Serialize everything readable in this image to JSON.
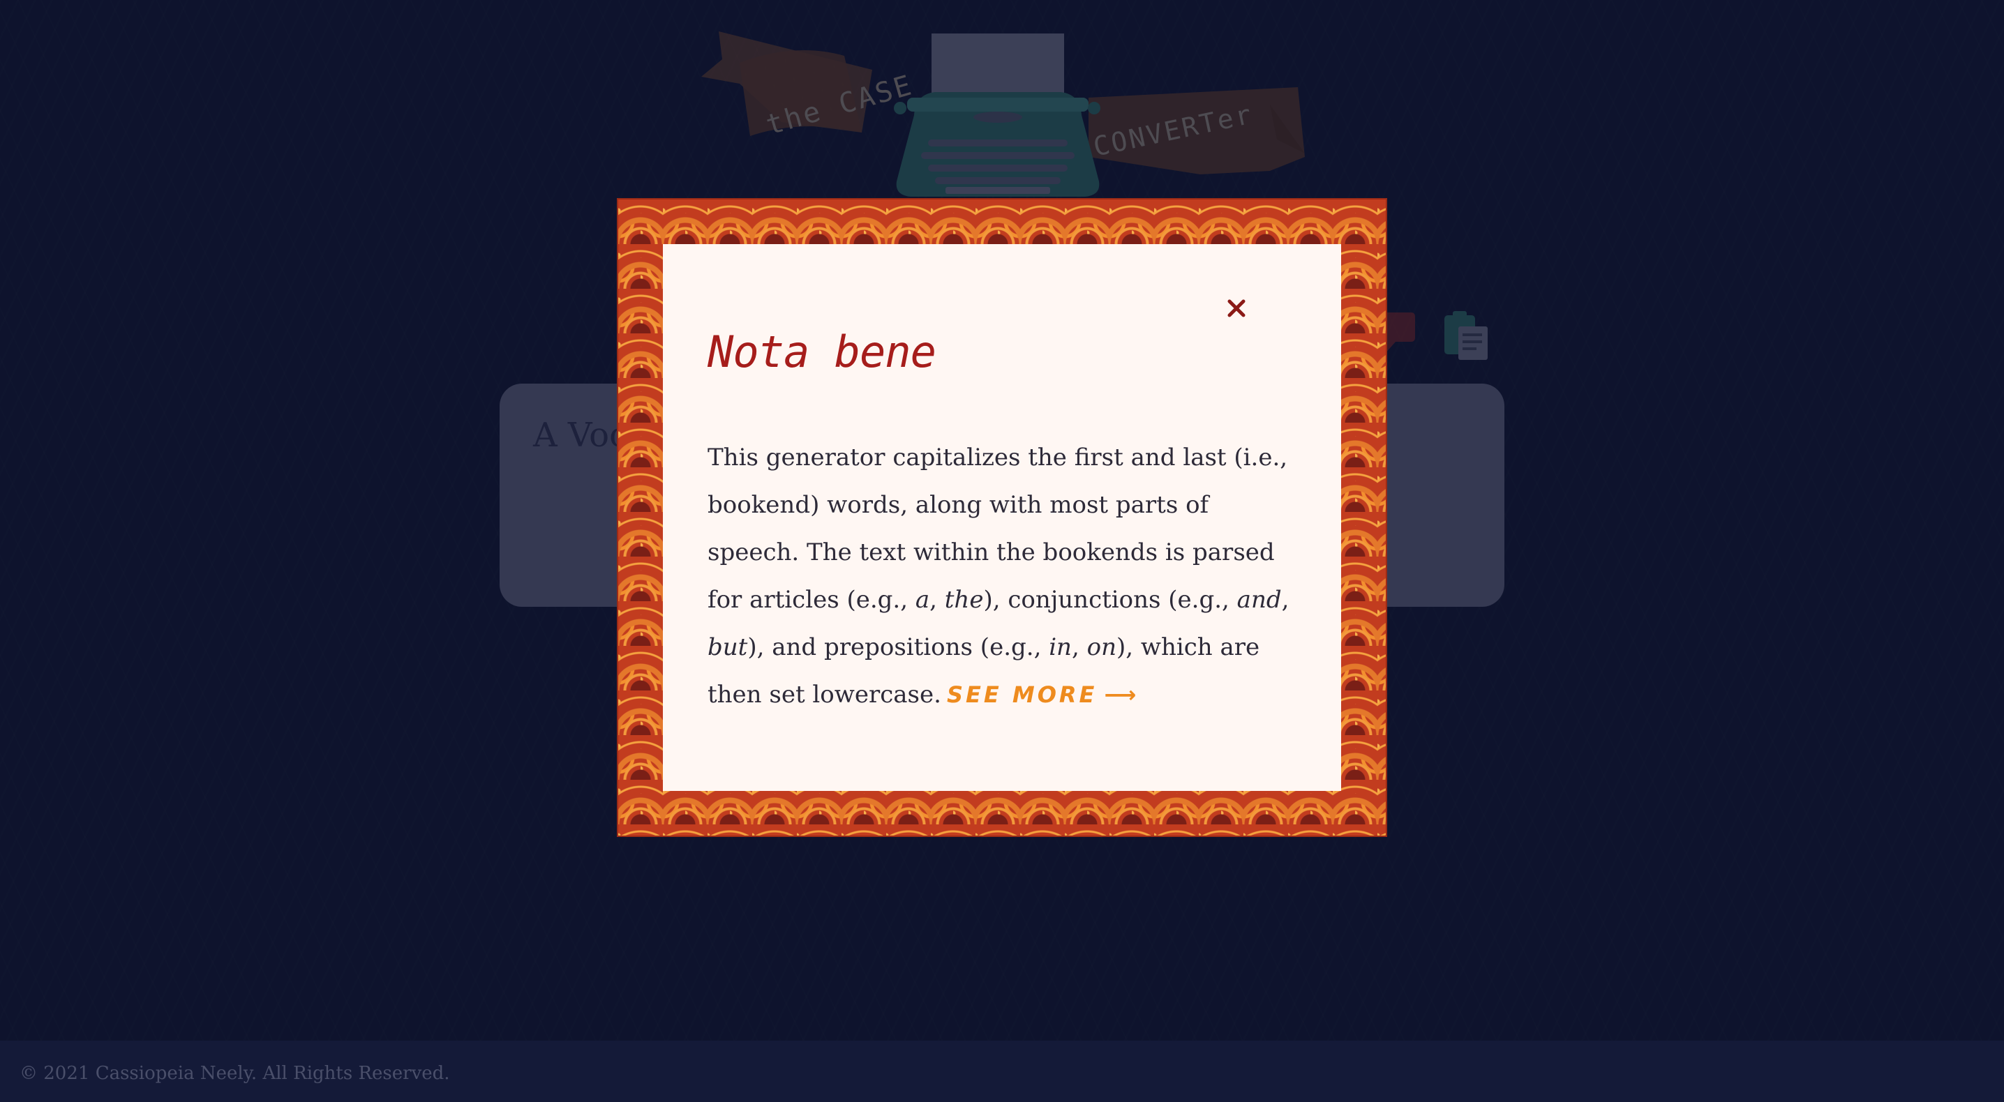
{
  "logo": {
    "left_ribbon": "the CASE",
    "right_ribbon": "CONVERTer"
  },
  "textbox": {
    "visible_text": "A Voc"
  },
  "modal": {
    "title": "Nota bene",
    "close_label": "×",
    "body_intro": "This generator capitalizes the first and last (i.e., bookend) words, along with most parts of speech. The text within the bookends is parsed for articles (e.g., ",
    "example_a": "a",
    "sep1": ", ",
    "example_the": "the",
    "body_mid1": "), conjunctions (e.g., ",
    "example_and": "and",
    "sep2": ", ",
    "example_but": "but",
    "body_mid2": "), and prepositions (e.g., ",
    "example_in": "in",
    "sep3": ", ",
    "example_on": "on",
    "body_end": "), which are then set lowercase.",
    "see_more": "SEE MORE",
    "see_more_arrow": "⟶"
  },
  "footer": {
    "copyright": "© 2021 Cassiopeia Neely. All Rights Reserved."
  },
  "colors": {
    "background": "#121833",
    "modal_frame": "#c23c1f",
    "modal_panel": "#fff7f3",
    "title": "#a61d1b",
    "see_more": "#ee8b1e",
    "typewriter": "#2f6f6a"
  },
  "icons": [
    "typewriter-icon",
    "speech-bubble-icon",
    "clipboard-icon",
    "close-icon"
  ]
}
